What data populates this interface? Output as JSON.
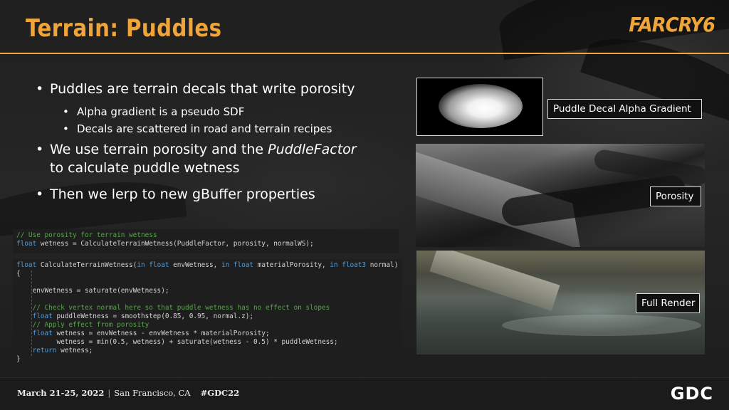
{
  "slide": {
    "title": "Terrain: Puddles",
    "brand_logo": "FARCRY6"
  },
  "bullets": {
    "item1": "Puddles are terrain decals that write porosity",
    "item1_sub1": "Alpha gradient is a pseudo SDF",
    "item1_sub2": "Decals are scattered in road and terrain recipes",
    "item2_prefix": "We use terrain porosity and the ",
    "item2_em": "PuddleFactor",
    "item2_suffix": "to calculate puddle wetness",
    "item3": "Then we lerp to new gBuffer properties"
  },
  "code_top": {
    "comment": "// Use porosity for terrain wetness",
    "kw": "float",
    "line": " wetness = CalculateTerrainWetness(PuddleFactor, porosity, normalWS);"
  },
  "code_main": {
    "sig_kw1": "float",
    "sig_1": " CalculateTerrainWetness(",
    "sig_kw2": "in float",
    "sig_2": " envWetness, ",
    "sig_kw3": "in float",
    "sig_3": " materialPorosity, ",
    "sig_kw4": "in float3",
    "sig_4": " normal)",
    "open": "{",
    "l1": "    envWetness = saturate(envWetness);",
    "l2_comment": "    // Check vertex normal here so that puddle wetness has no effect on slopes",
    "l3_kw": "    float",
    "l3": " puddleWetness = smoothstep(0.85, 0.95, normal.z);",
    "l4_comment": "    // Apply effect from porosity",
    "l5_kw": "    float",
    "l5": " wetness = envWetness - envWetness * materialPorosity;",
    "l6": "          wetness = min(0.5, wetness) + saturate(wetness - 0.5) * puddleWetness;",
    "l7_kw": "    return",
    "l7": " wetness;",
    "close": "}"
  },
  "images": {
    "decal_label": "Puddle Decal Alpha Gradient",
    "porosity_label": "Porosity",
    "render_label": "Full Render"
  },
  "footer": {
    "date": "March 21-25, 2022",
    "separator": "|",
    "location": "San Francisco, CA",
    "hashtag": "#GDC22",
    "logo": "GDC"
  }
}
